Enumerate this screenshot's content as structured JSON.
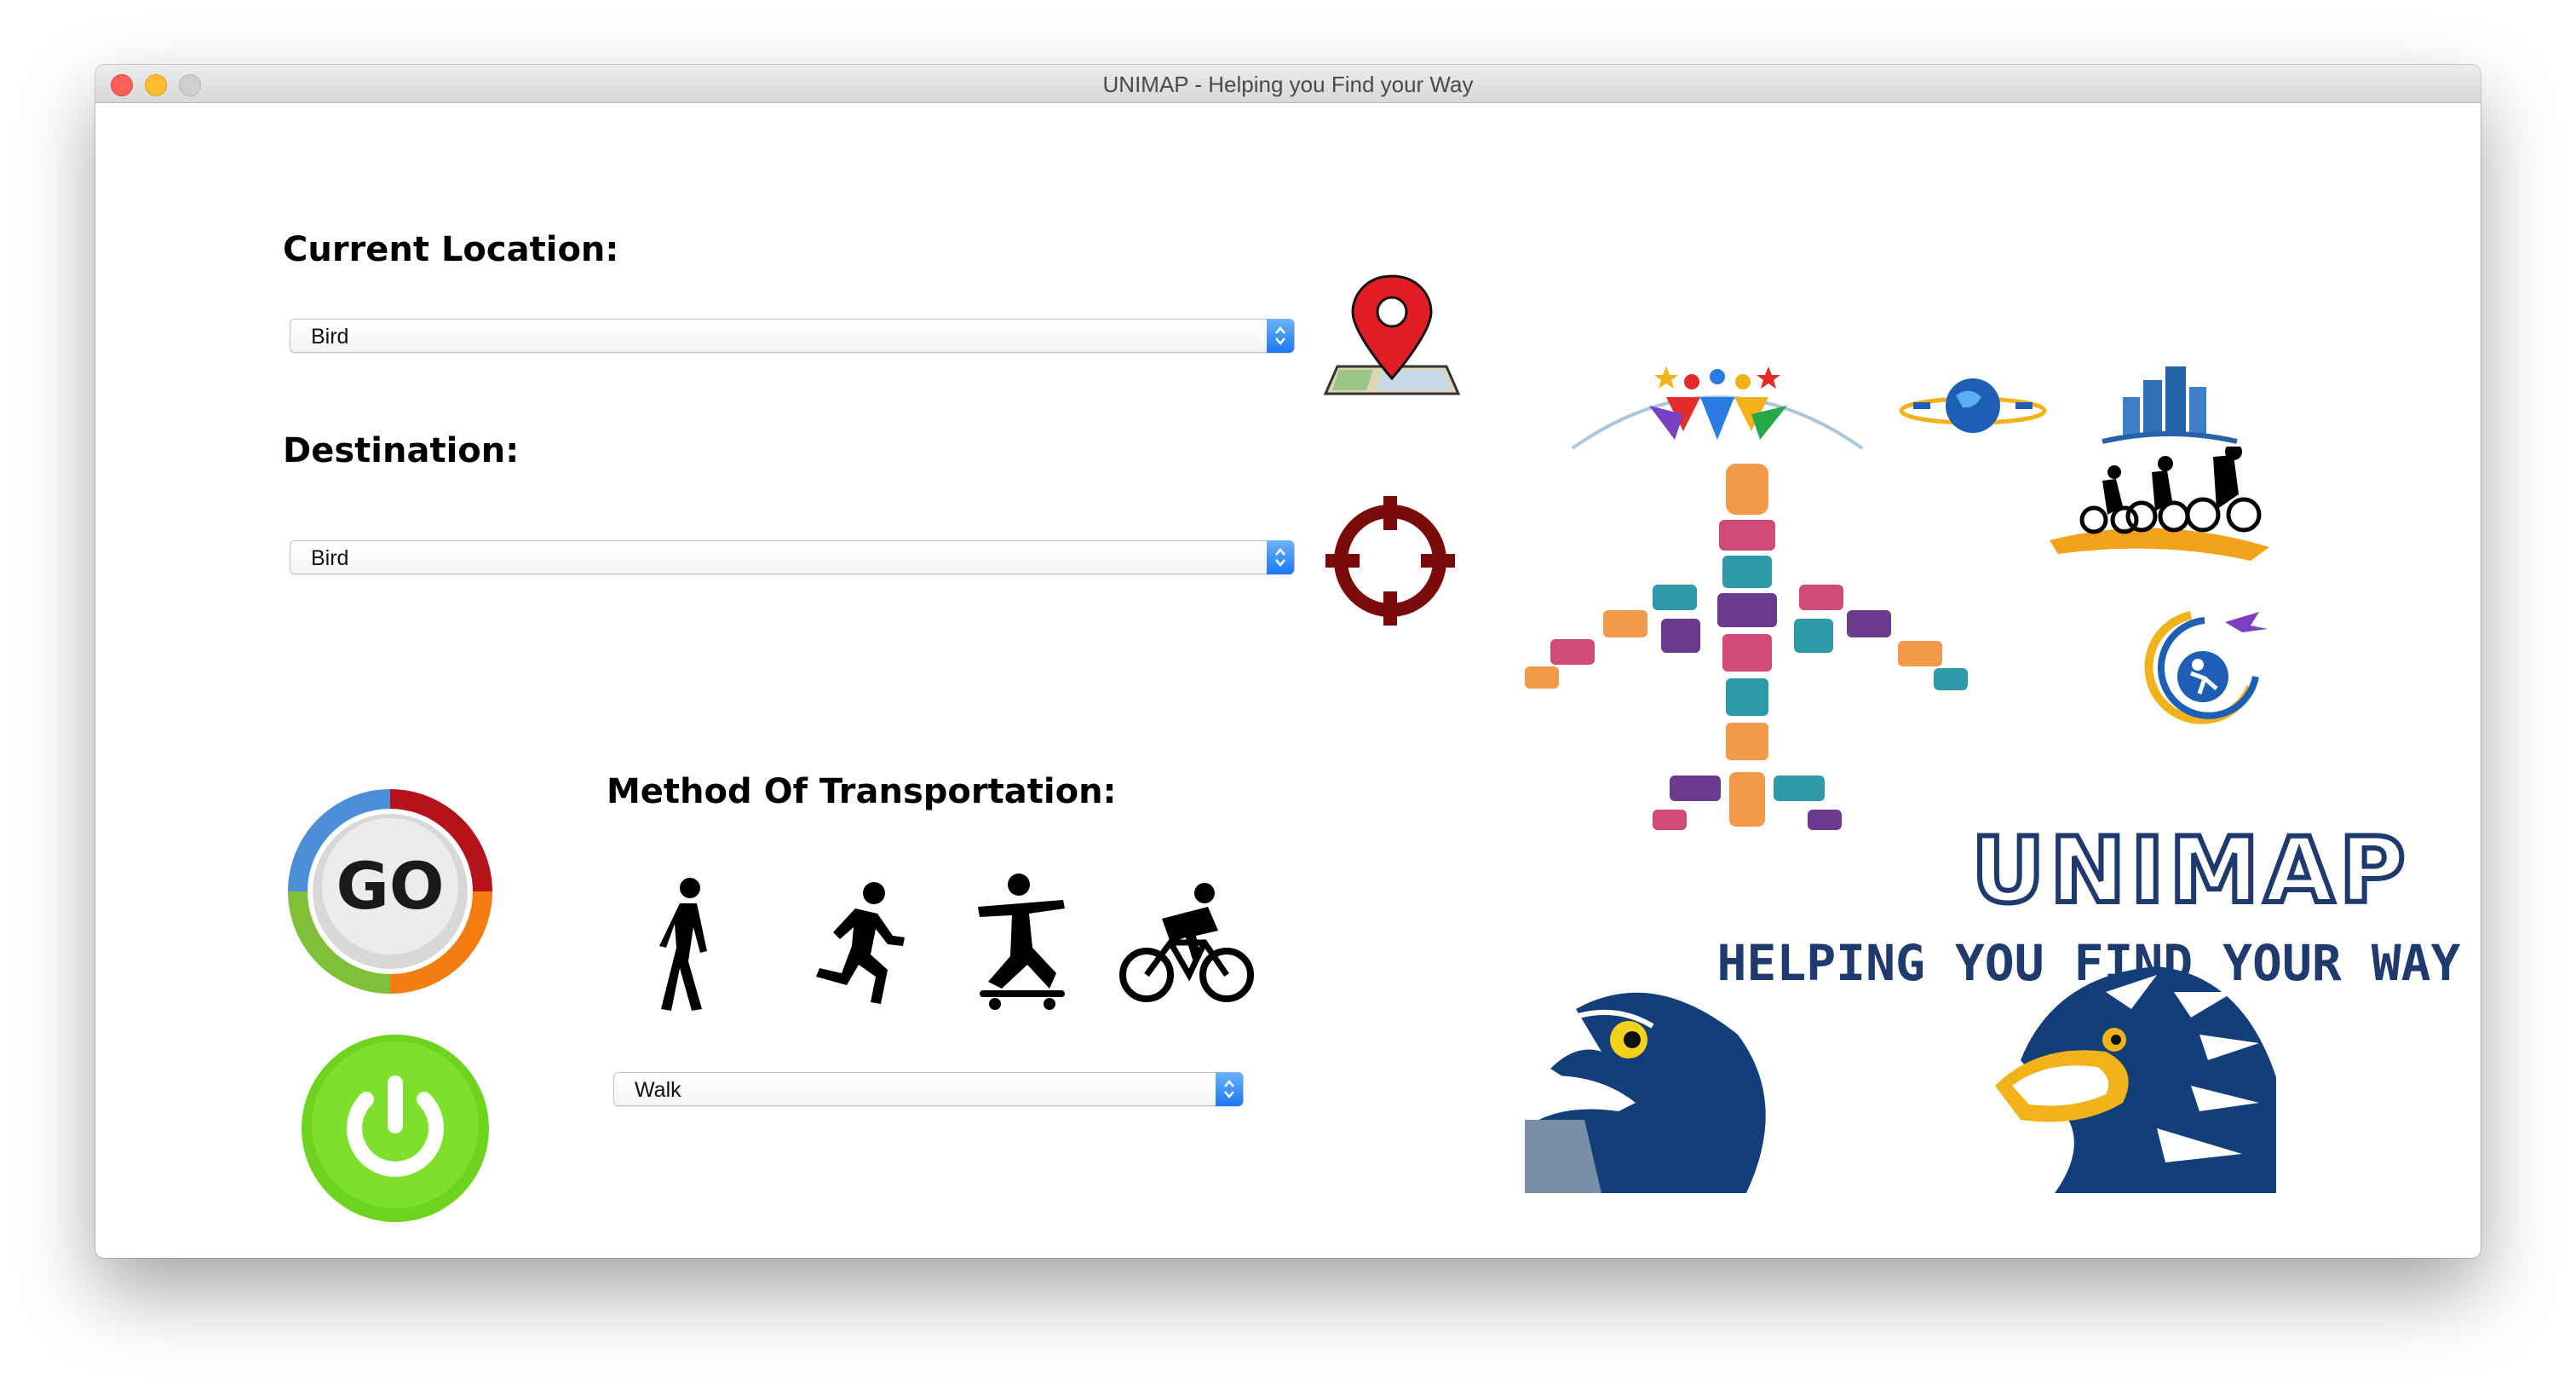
{
  "window": {
    "title": "UNIMAP - Helping you Find your Way"
  },
  "form": {
    "current_location": {
      "label": "Current Location:",
      "selected": "Bird"
    },
    "destination": {
      "label": "Destination:",
      "selected": "Bird"
    },
    "transport": {
      "label": "Method Of Transportation:",
      "selected": "Walk"
    }
  },
  "buttons": {
    "go_label": "GO"
  },
  "transport_icons": [
    "walk-icon",
    "run-icon",
    "skateboard-icon",
    "bike-icon"
  ],
  "logo": {
    "name": "UNIMAP",
    "tagline": "HELPING YOU FIND YOUR WAY"
  },
  "colors": {
    "go_green": "#6dd31c",
    "map_pin_red": "#e21d25",
    "target_maroon": "#7b0a0a",
    "logo_navy": "#1f3a6e",
    "eagle_blue": "#123f7a",
    "accent_blue": "#1878f3"
  }
}
